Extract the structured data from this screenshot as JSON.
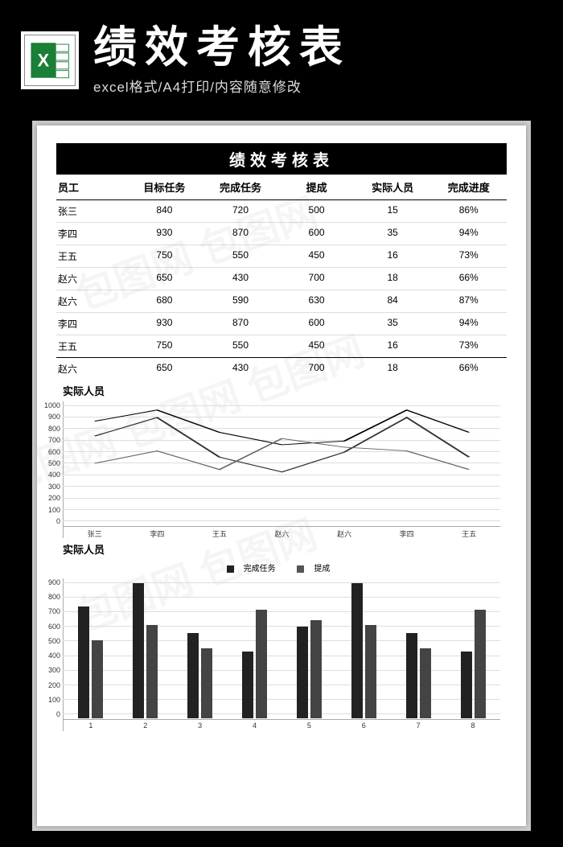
{
  "banner": {
    "title": "绩效考核表",
    "subtitle": "excel格式/A4打印/内容随意修改"
  },
  "table": {
    "title": "绩效考核表",
    "headers": [
      "员工",
      "目标任务",
      "完成任务",
      "提成",
      "实际人员",
      "完成进度"
    ],
    "rows": [
      [
        "张三",
        "840",
        "720",
        "500",
        "15",
        "86%"
      ],
      [
        "李四",
        "930",
        "870",
        "600",
        "35",
        "94%"
      ],
      [
        "王五",
        "750",
        "550",
        "450",
        "16",
        "73%"
      ],
      [
        "赵六",
        "650",
        "430",
        "700",
        "18",
        "66%"
      ],
      [
        "赵六",
        "680",
        "590",
        "630",
        "84",
        "87%"
      ],
      [
        "李四",
        "930",
        "870",
        "600",
        "35",
        "94%"
      ],
      [
        "王五",
        "750",
        "550",
        "450",
        "16",
        "73%"
      ],
      [
        "赵六",
        "650",
        "430",
        "700",
        "18",
        "66%"
      ]
    ]
  },
  "chart_data": [
    {
      "type": "line",
      "title": "实际人员",
      "categories": [
        "张三",
        "李四",
        "王五",
        "赵六",
        "赵六",
        "李四",
        "王五"
      ],
      "series": [
        {
          "name": "目标任务",
          "values": [
            840,
            930,
            750,
            650,
            680,
            930,
            750
          ]
        },
        {
          "name": "完成任务",
          "values": [
            720,
            870,
            550,
            430,
            590,
            870,
            550
          ]
        },
        {
          "name": "提成",
          "values": [
            500,
            600,
            450,
            700,
            630,
            600,
            450
          ]
        }
      ],
      "ylim": [
        0,
        1000
      ],
      "ystep": 100
    },
    {
      "type": "bar",
      "title": "实际人员",
      "legend": [
        "完成任务",
        "提成"
      ],
      "categories": [
        "1",
        "2",
        "3",
        "4",
        "5",
        "6",
        "7",
        "8"
      ],
      "series": [
        {
          "name": "完成任务",
          "values": [
            720,
            870,
            550,
            430,
            590,
            870,
            550,
            430
          ]
        },
        {
          "name": "提成",
          "values": [
            500,
            600,
            450,
            700,
            630,
            600,
            450,
            700
          ]
        }
      ],
      "ylim": [
        0,
        900
      ],
      "ystep": 100
    }
  ]
}
